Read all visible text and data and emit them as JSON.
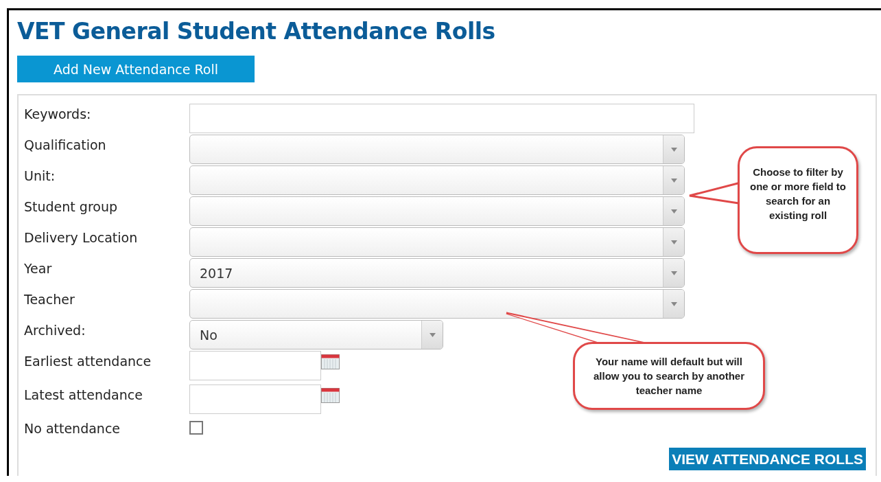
{
  "page": {
    "title": "VET General Student Attendance Rolls"
  },
  "add_button": "Add New Attendance Roll",
  "fields": [
    {
      "label": "Keywords:",
      "kind": "text"
    },
    {
      "label": "Qualification",
      "kind": "select"
    },
    {
      "label": "Unit:",
      "kind": "select"
    },
    {
      "label": "Student group",
      "kind": "select"
    },
    {
      "label": "Delivery Location",
      "kind": "select"
    },
    {
      "label": "Year",
      "kind": "select",
      "value": "2017"
    },
    {
      "label": "Teacher",
      "kind": "select"
    },
    {
      "label": "Archived:",
      "kind": "short_select",
      "value": "No"
    },
    {
      "label": "Earliest attendance",
      "kind": "date"
    },
    {
      "label": "Latest attendance",
      "kind": "date"
    },
    {
      "label": "No attendance",
      "kind": "checkbox",
      "checked": false
    }
  ],
  "submit_button": "VIEW ATTENDANCE ROLLS",
  "callouts": [
    {
      "text": "Choose to filter by one or more field to search for an existing roll"
    },
    {
      "text": "Your name will default but will allow you to search by another teacher name"
    }
  ]
}
